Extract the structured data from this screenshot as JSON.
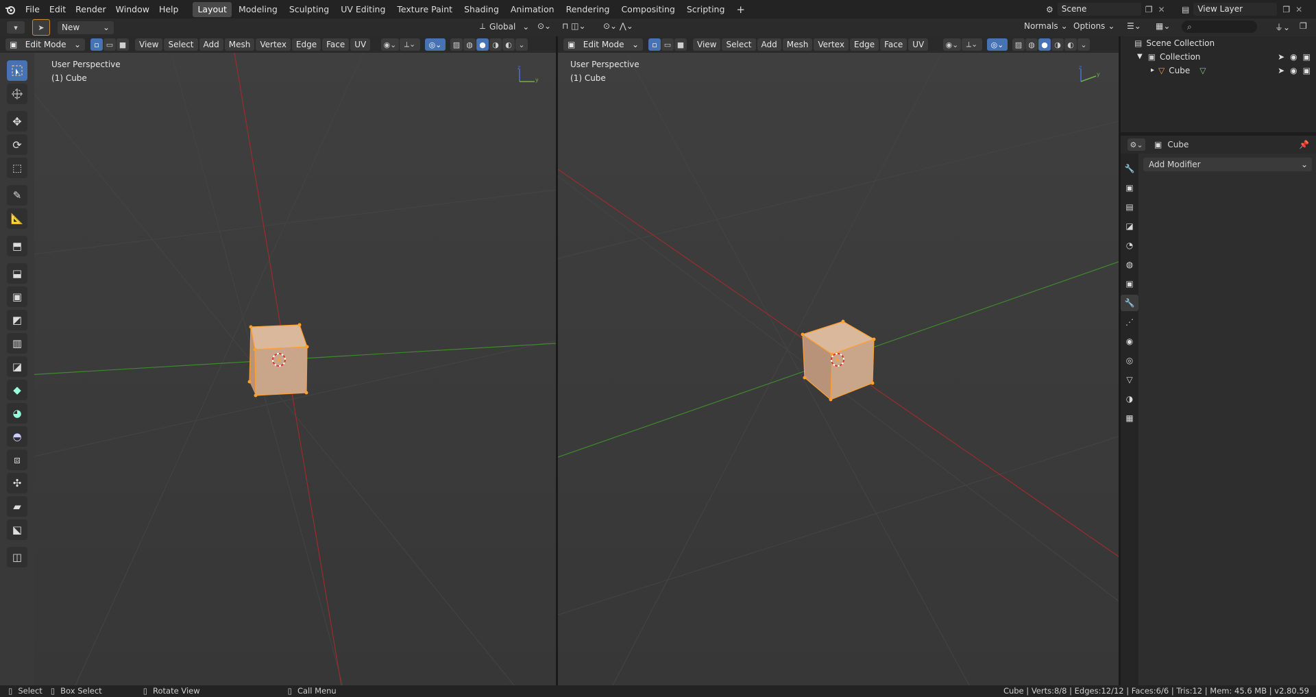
{
  "app": {
    "menu": [
      "File",
      "Edit",
      "Render",
      "Window",
      "Help"
    ],
    "workspaces": [
      "Layout",
      "Modeling",
      "Sculpting",
      "UV Editing",
      "Texture Paint",
      "Shading",
      "Animation",
      "Rendering",
      "Compositing",
      "Scripting"
    ],
    "active_workspace": "Layout",
    "scene": "Scene",
    "view_layer": "View Layer"
  },
  "toolheader": {
    "new_label": "New",
    "orientation": "Global",
    "normals": "Normals",
    "options": "Options"
  },
  "viewports": [
    {
      "mode": "Edit Mode",
      "menus": [
        "View",
        "Select",
        "Add",
        "Mesh",
        "Vertex",
        "Edge",
        "Face",
        "UV"
      ],
      "perspective": "User Perspective",
      "object": "(1) Cube"
    },
    {
      "mode": "Edit Mode",
      "menus": [
        "View",
        "Select",
        "Add",
        "Mesh",
        "Vertex",
        "Edge",
        "Face",
        "UV"
      ],
      "perspective": "User Perspective",
      "object": "(1) Cube"
    }
  ],
  "outliner": {
    "scene_collection": "Scene Collection",
    "collection": "Collection",
    "object": "Cube"
  },
  "properties": {
    "object_name": "Cube",
    "add_modifier": "Add Modifier"
  },
  "statusbar": {
    "select": "Select",
    "box_select": "Box Select",
    "rotate_view": "Rotate View",
    "call_menu": "Call Menu",
    "stats": "Cube | Verts:8/8 | Edges:12/12 | Faces:6/6 | Tris:12 | Mem: 45.6 MB | v2.80.59"
  },
  "colors": {
    "accent": "#4772b3",
    "x_axis": "#9c2c2c",
    "y_axis": "#3f8a2d",
    "selection": "#ff9f2d"
  }
}
